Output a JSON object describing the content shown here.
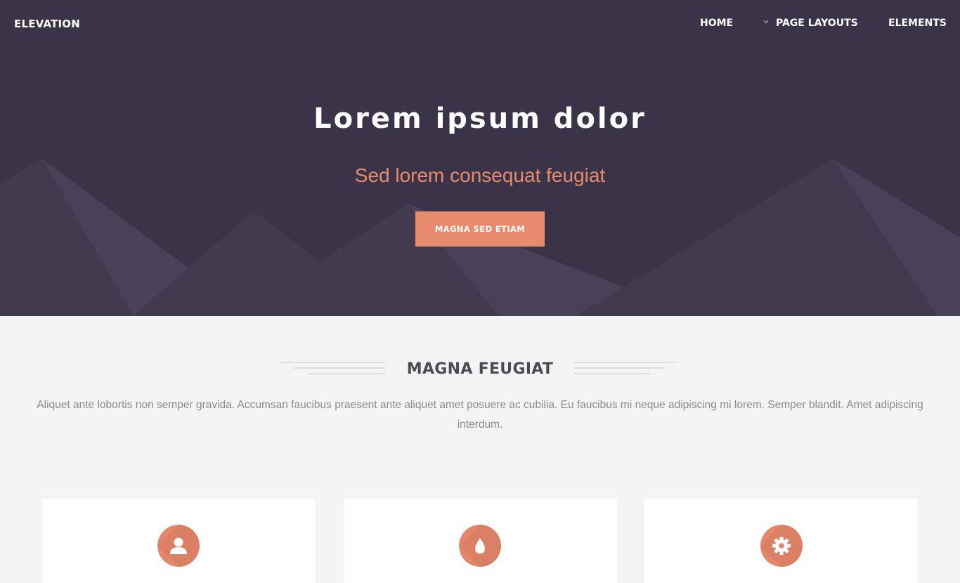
{
  "header": {
    "logo": "ELEVATION",
    "nav": {
      "home": "HOME",
      "page_layouts": "PAGE LAYOUTS",
      "elements": "ELEMENTS"
    }
  },
  "hero": {
    "title": "Lorem ipsum dolor",
    "subtitle": "Sed lorem consequat feugiat",
    "button_label": "MAGNA SED ETIAM"
  },
  "section": {
    "title": "MAGNA FEUGIAT",
    "text": "Aliquet ante lobortis non semper gravida. Accumsan faucibus praesent ante aliquet amet posuere ac cubilia. Eu faucibus mi neque adipiscing mi lorem. Semper blandit. Amet adipiscing interdum."
  },
  "cards": [
    {
      "icon": "user-icon"
    },
    {
      "icon": "tint-icon"
    },
    {
      "icon": "gear-icon"
    }
  ],
  "colors": {
    "hero_bg": "#3b3347",
    "accent": "#e88b6d",
    "page_bg": "#f4f4f4",
    "heading": "#4d4a55",
    "body_text": "#8a8a92"
  }
}
